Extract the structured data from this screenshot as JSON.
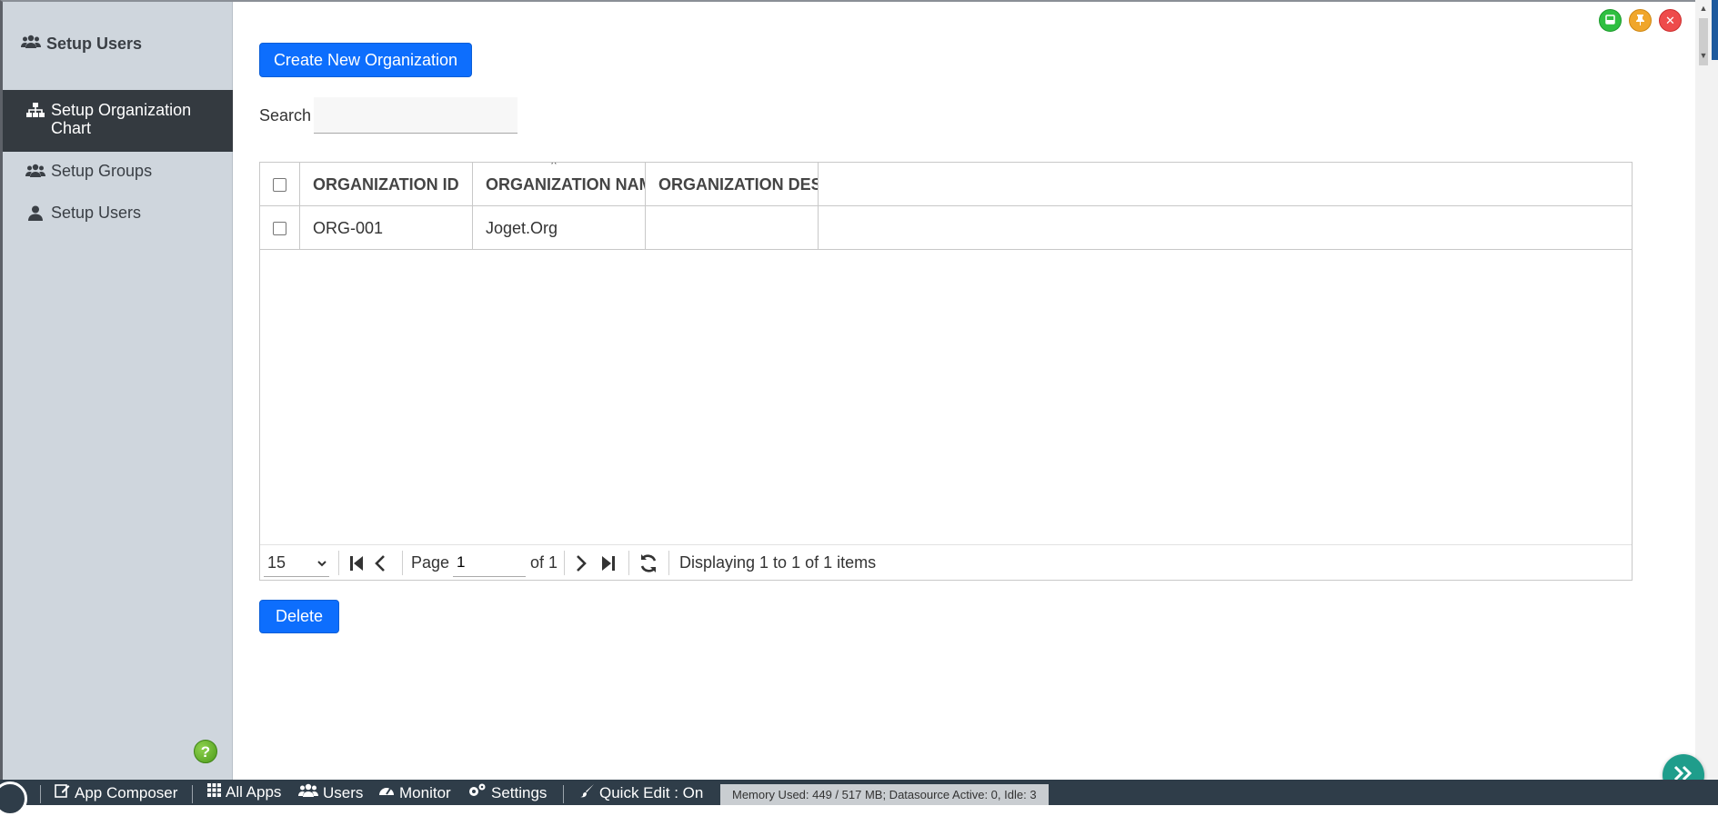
{
  "sidebar": {
    "header": "Setup Users",
    "items": [
      {
        "label": "Setup Organization Chart",
        "icon": "sitemap-icon",
        "active": true
      },
      {
        "label": "Setup Groups",
        "icon": "users-icon",
        "active": false
      },
      {
        "label": "Setup Users",
        "icon": "user-icon",
        "active": false
      }
    ],
    "help_icon": "?"
  },
  "window_controls": {
    "minimize_icon": "window-minimize-icon",
    "pin_icon": "pin-icon",
    "close_icon": "close-icon"
  },
  "toolbar": {
    "create_label": "Create New Organization",
    "delete_label": "Delete"
  },
  "search": {
    "label": "Search",
    "value": ""
  },
  "table": {
    "columns": [
      "ORGANIZATION ID",
      "ORGANIZATION NAME",
      "ORGANIZATION DESCRIPTION"
    ],
    "rows": [
      {
        "id": "ORG-001",
        "name": "Joget.Org",
        "description": ""
      }
    ]
  },
  "pager": {
    "page_size": "15",
    "page_label": "Page",
    "page_value": "1",
    "of_label": "of 1",
    "status": "Displaying 1 to 1 of 1 items"
  },
  "bottombar": {
    "app_composer": "App Composer",
    "all_apps": "All Apps",
    "users": "Users",
    "monitor": "Monitor",
    "settings": "Settings",
    "quick_edit": "Quick Edit : On",
    "memory": "Memory Used: 449 / 517 MB; Datasource Active: 0, Idle: 3"
  },
  "colors": {
    "primary": "#0d6efd",
    "sidebar_bg": "#cfd6dd",
    "sidebar_active": "#343a40",
    "bottombar_bg": "#2f3d49"
  }
}
